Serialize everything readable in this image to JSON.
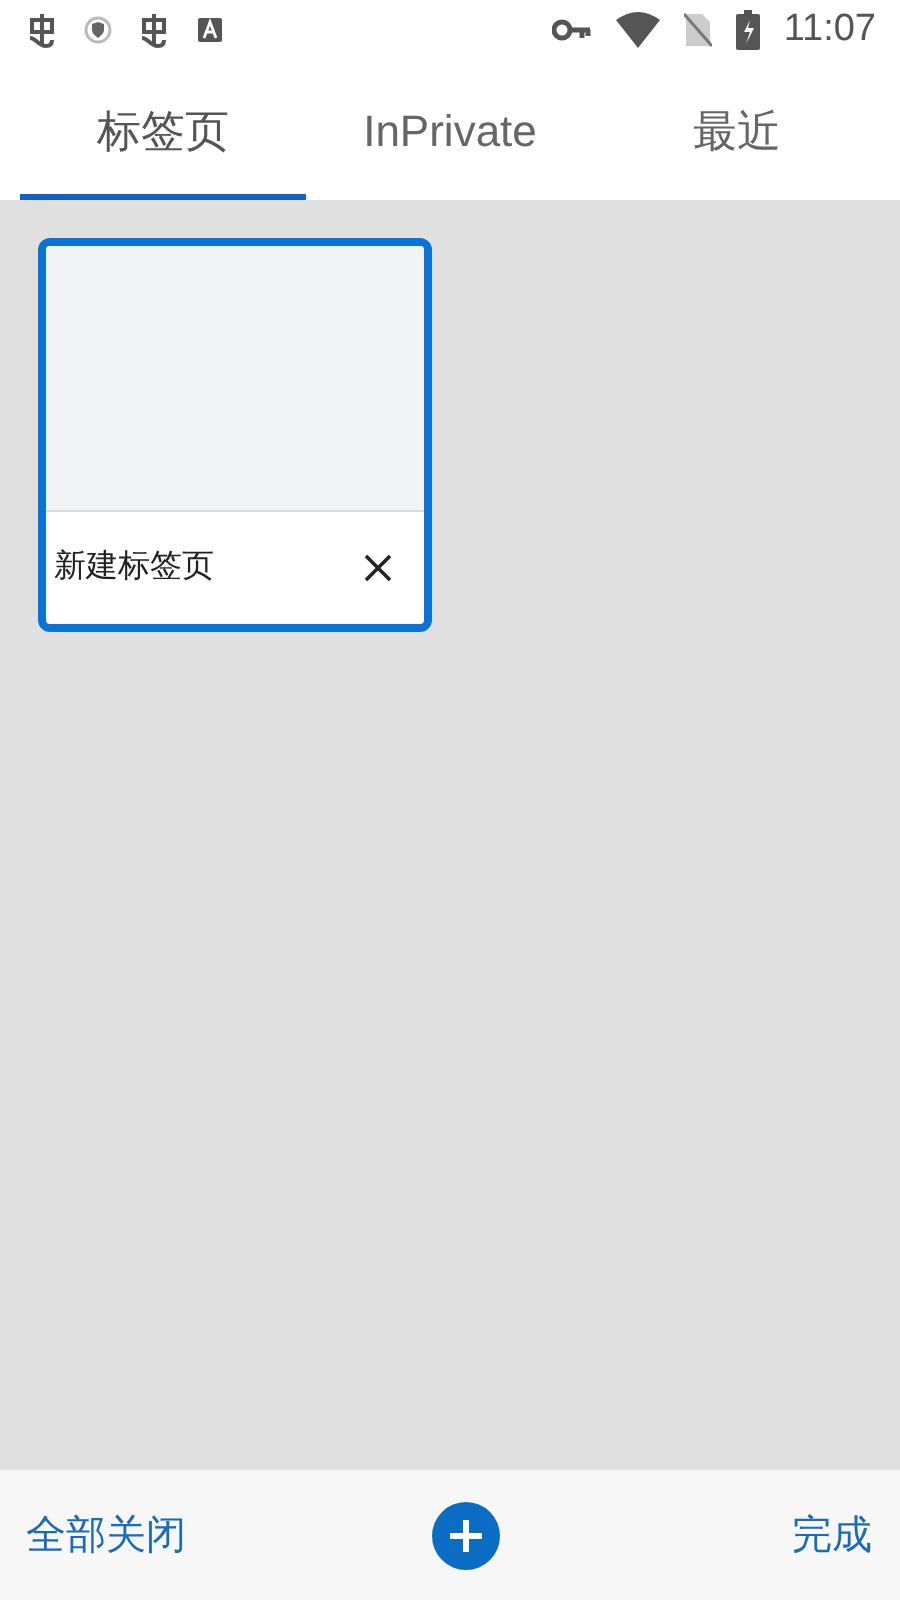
{
  "status_bar": {
    "time": "11:07"
  },
  "tabs": [
    {
      "label": "标签页",
      "selected": true
    },
    {
      "label": "InPrivate",
      "selected": false
    },
    {
      "label": "最近",
      "selected": false
    }
  ],
  "tab_cards": [
    {
      "title": "新建标签页",
      "selected": true
    }
  ],
  "bottom_bar": {
    "close_all": "全部关闭",
    "done": "完成"
  }
}
